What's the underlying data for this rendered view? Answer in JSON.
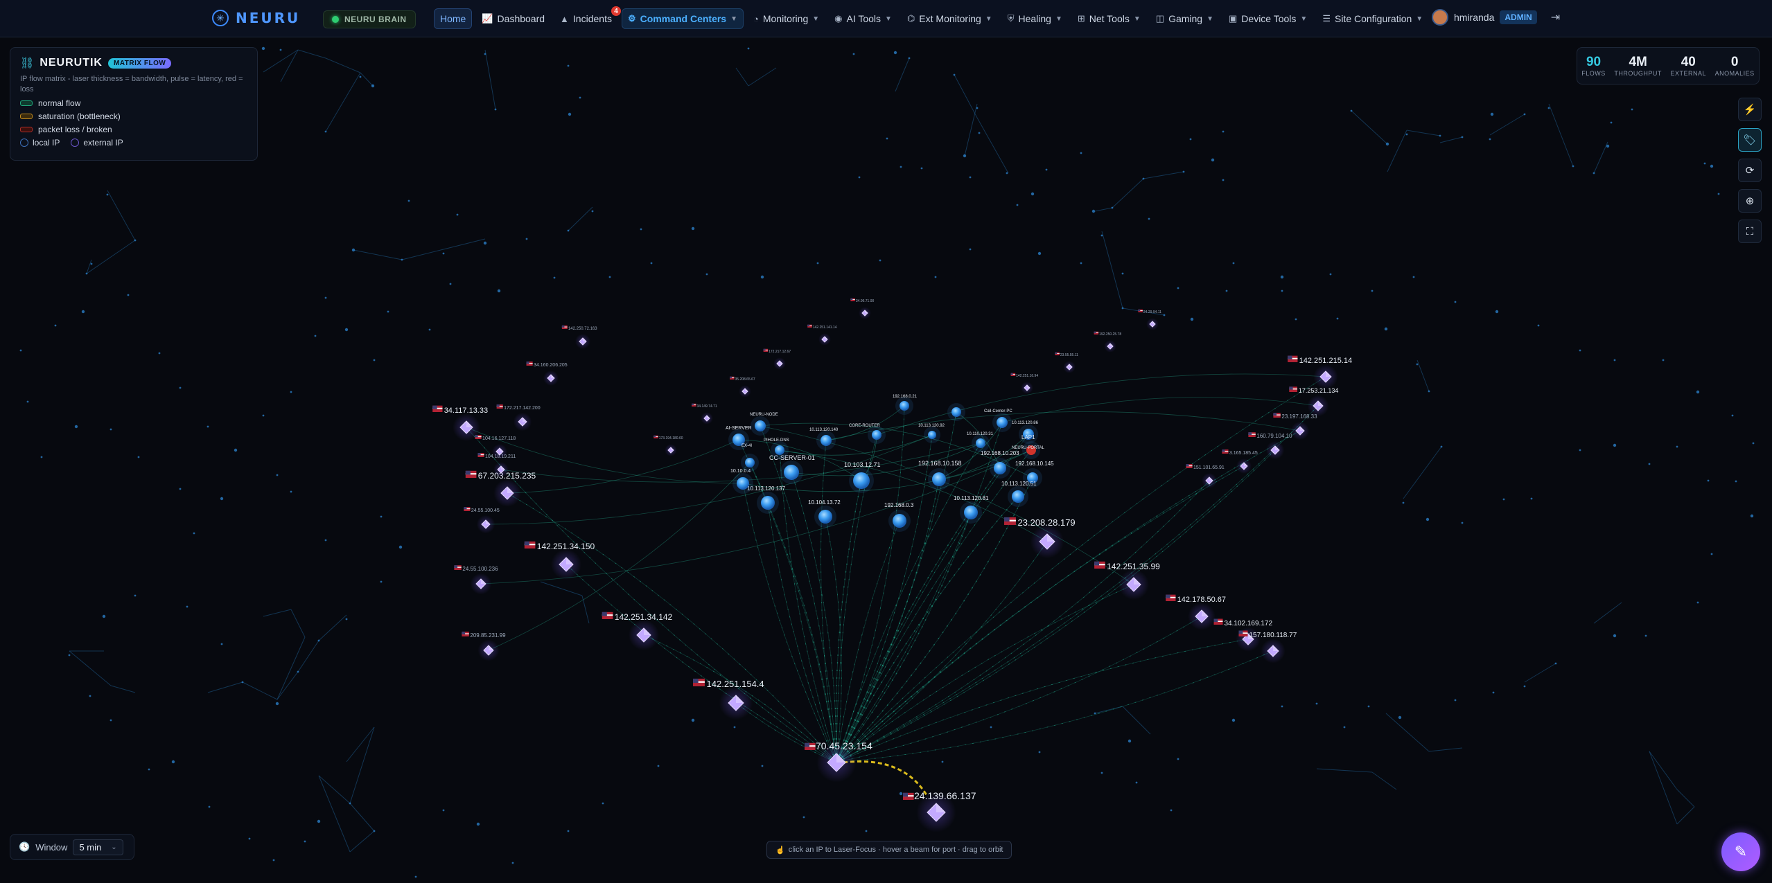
{
  "brand": {
    "name": "NEURU",
    "logo_icon": "neuru-logo-icon"
  },
  "brain": {
    "label": "NEURU BRAIN",
    "status_color": "#2ecc71"
  },
  "nav": [
    {
      "label": "Home",
      "icon": "",
      "caret": false,
      "active": true
    },
    {
      "label": "Dashboard",
      "icon": "chart-icon",
      "caret": false
    },
    {
      "label": "Incidents",
      "icon": "warning-icon",
      "caret": false,
      "badge": "4"
    },
    {
      "label": "Command Centers",
      "icon": "command-icon",
      "caret": true,
      "highlight": true
    },
    {
      "label": "Monitoring",
      "icon": "gauge-icon",
      "caret": true
    },
    {
      "label": "AI Tools",
      "icon": "brain-icon",
      "caret": true
    },
    {
      "label": "Ext Monitoring",
      "icon": "satellite-icon",
      "caret": true
    },
    {
      "label": "Healing",
      "icon": "shield-icon",
      "caret": true
    },
    {
      "label": "Net Tools",
      "icon": "network-icon",
      "caret": true
    },
    {
      "label": "Gaming",
      "icon": "gamepad-icon",
      "caret": true
    },
    {
      "label": "Device Tools",
      "icon": "device-icon",
      "caret": true
    },
    {
      "label": "Site Configuration",
      "icon": "sliders-icon",
      "caret": true
    }
  ],
  "user": {
    "name": "hmiranda",
    "role": "ADMIN"
  },
  "legend": {
    "title": "NEURUTIK",
    "pill": "MATRIX FLOW",
    "description": "IP flow matrix - laser thickness = bandwidth, pulse = latency, red = loss",
    "items": [
      {
        "label": "normal flow",
        "color": "#1fa57a"
      },
      {
        "label": "saturation (bottleneck)",
        "color": "#c08a1e"
      },
      {
        "label": "packet loss / broken",
        "color": "#b0302a"
      }
    ],
    "local_label": "local IP",
    "external_label": "external IP"
  },
  "stats": [
    {
      "value": "90",
      "label": "FLOWS",
      "accent": true
    },
    {
      "value": "4M",
      "label": "THROUGHPUT"
    },
    {
      "value": "40",
      "label": "EXTERNAL"
    },
    {
      "value": "0",
      "label": "ANOMALIES"
    }
  ],
  "tools": [
    {
      "icon": "bolt-icon",
      "glyph": "⚡",
      "active": false
    },
    {
      "icon": "tag-icon",
      "glyph": "🏷",
      "active": true
    },
    {
      "icon": "refresh-icon",
      "glyph": "⟳",
      "active": false
    },
    {
      "icon": "target-icon",
      "glyph": "⊕",
      "active": false
    },
    {
      "icon": "fullscreen-icon",
      "glyph": "⛶",
      "active": false
    }
  ],
  "window": {
    "label": "Window",
    "value": "5 min"
  },
  "hint": "click an IP to Laser-Focus · hover a beam for port · drag to orbit",
  "hub": {
    "ip": "70.45.23.154"
  },
  "bottleneck_peer": {
    "ip": "24.139.66.137"
  },
  "local_nodes": [
    {
      "label": "10.103.12.71"
    },
    {
      "label": "192.168.10.158"
    },
    {
      "label": "192.168.10.203"
    },
    {
      "label": "192.168.10.145"
    },
    {
      "label": "10.113.120.51"
    },
    {
      "label": "10.113.120.81"
    },
    {
      "label": "192.168.0.3"
    },
    {
      "label": "10.104.13.72"
    },
    {
      "label": "10.113.120.137"
    },
    {
      "label": "CC-SERVER-01"
    },
    {
      "label": "10.10.0.4"
    },
    {
      "label": "AI-SERVER"
    },
    {
      "label": "PIHOLE-DNS"
    },
    {
      "label": "NEURU-NODE"
    },
    {
      "label": "10.113.120.140"
    },
    {
      "label": "192.168.0.21"
    },
    {
      "label": "CORE-ROUTER"
    },
    {
      "label": "10.113.120.86"
    },
    {
      "label": "LAP1"
    },
    {
      "label": "Call-Center-PC"
    },
    {
      "label": "10.110.120.31"
    },
    {
      "label": "10.113.120.92"
    },
    {
      "label": "NEURU-PORTAL"
    },
    {
      "label": "EX-4I"
    }
  ],
  "external_nodes": [
    {
      "ip": "34.117.13.33"
    },
    {
      "ip": "67.203.215.235"
    },
    {
      "ip": "142.251.34.150"
    },
    {
      "ip": "142.251.34.142"
    },
    {
      "ip": "142.251.154.4"
    },
    {
      "ip": "23.208.28.179"
    },
    {
      "ip": "142.251.35.99"
    },
    {
      "ip": "142.178.50.67"
    },
    {
      "ip": "34.102.169.172"
    },
    {
      "ip": "157.180.118.77"
    },
    {
      "ip": "142.251.215.14"
    },
    {
      "ip": "17.253.21.134"
    },
    {
      "ip": "23.197.168.33"
    },
    {
      "ip": "160.79.104.10"
    },
    {
      "ip": "3.165.185.45"
    },
    {
      "ip": "151.101.65.91"
    },
    {
      "ip": "104.18.19.211"
    },
    {
      "ip": "24.55.100.45"
    },
    {
      "ip": "24.55.100.236"
    },
    {
      "ip": "209.85.231.99"
    },
    {
      "ip": "172.217.142.200"
    },
    {
      "ip": "104.16.127.118"
    },
    {
      "ip": "34.160.206.205"
    },
    {
      "ip": "142.250.72.163"
    },
    {
      "ip": "172.217.12.67"
    },
    {
      "ip": "142.251.141.14"
    },
    {
      "ip": "34.96.71.90"
    },
    {
      "ip": "24.29.94.11"
    },
    {
      "ip": "192.250.25.78"
    },
    {
      "ip": "23.55.55.11"
    },
    {
      "ip": "142.251.16.94"
    },
    {
      "ip": "35.208.65.67"
    },
    {
      "ip": "34.149.74.71"
    },
    {
      "ip": "173.194.180.60"
    }
  ]
}
